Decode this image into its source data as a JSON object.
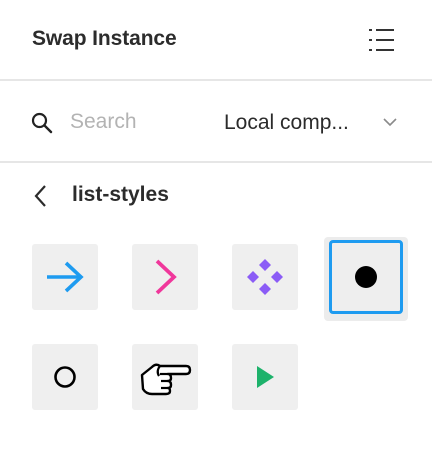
{
  "header": {
    "title": "Swap Instance",
    "list_toggle_icon": "list-view-icon"
  },
  "search": {
    "placeholder": "Search",
    "value": "",
    "icon": "search-icon"
  },
  "library_select": {
    "selected": "Local comp...",
    "icon": "chevron-down-icon"
  },
  "breadcrumb": {
    "back_icon": "chevron-left-icon",
    "folder": "list-styles"
  },
  "components": [
    {
      "icon": "arrow-right-icon",
      "color": "#1e9bf0",
      "selected": false
    },
    {
      "icon": "chevron-right-icon",
      "color": "#f0379b",
      "selected": false
    },
    {
      "icon": "component-diamond-icon",
      "color": "#8b5cf6",
      "selected": false
    },
    {
      "icon": "filled-circle-icon",
      "color": "#000000",
      "selected": true
    },
    {
      "icon": "hollow-circle-icon",
      "color": "#000000",
      "selected": false
    },
    {
      "icon": "pointing-hand-icon",
      "color": "#000000",
      "selected": false
    },
    {
      "icon": "play-triangle-icon",
      "color": "#1db26b",
      "selected": false
    }
  ],
  "colors": {
    "accent": "#1e9bf0",
    "divider": "#e6e6e6",
    "tile_bg": "#efefef"
  }
}
